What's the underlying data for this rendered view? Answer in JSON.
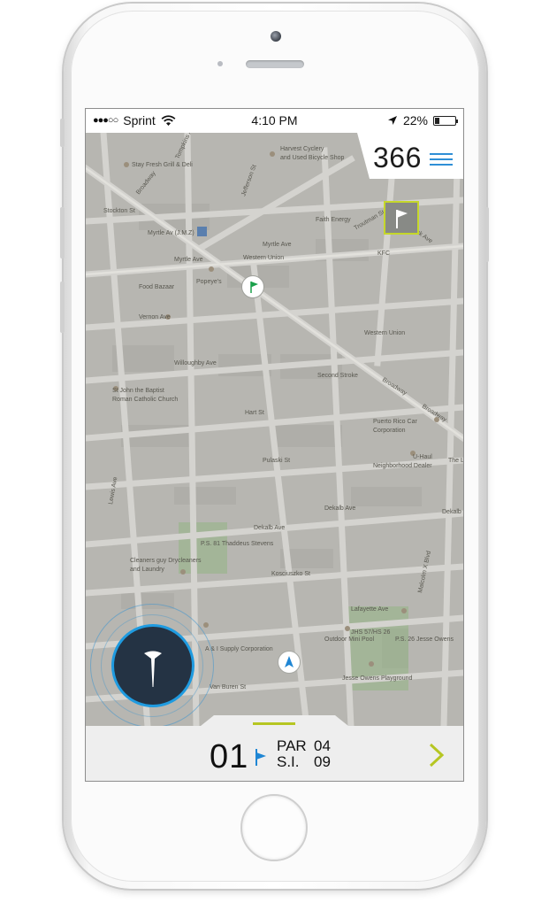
{
  "status_bar": {
    "signal": "●●●○○",
    "carrier": "Sprint",
    "time": "4:10 PM",
    "battery": "22%",
    "battery_level": 0.22
  },
  "map": {
    "labels": [
      "Stay Fresh Grill & Deli",
      "Harvest Cyclery",
      "and Used Bicycle Shop",
      "Stockton St",
      "Faith Energy",
      "Myrtle Av (J.M.Z)",
      "Myrtle Ave",
      "Myrtle Ave",
      "Western Union",
      "KFC",
      "Popeye's",
      "Food Bazaar",
      "Vernon Ave",
      "Western Union",
      "Willoughby Ave",
      "Second Stroke",
      "St John the Baptist",
      "Roman Catholic Church",
      "Hart St",
      "Puerto Rico Car",
      "Corporation",
      "Pulaski St",
      "U-Haul",
      "Neighborhood Dealer",
      "The Livin",
      "Dekalb Ave",
      "Dekalb Ave",
      "P.S. 81 Thaddeus Stevens",
      "Cleaners guy Drycleaners",
      "and Laundry",
      "Kosciuszko St",
      "Lafayette Ave",
      "JHS 57/HS 26",
      "Outdoor Mini Pool",
      "P.S. 26 Jesse Owens",
      "A & I Supply Corporation",
      "Jesse Owens Playground",
      "Van Buren St",
      "Broadway",
      "Broadway",
      "Broadway",
      "Malcolm X Blvd",
      "Lewis Ave",
      "Tompkins Ave",
      "Bushwick Ave",
      "Jefferson St",
      "Troutman St",
      "Dekalb"
    ]
  },
  "distance": {
    "value": "366"
  },
  "hole_bar": {
    "hole_number": "01",
    "par_label": "PAR",
    "par_value": "04",
    "si_label": "S.I.",
    "si_value": "09"
  },
  "colors": {
    "accent_blue": "#2f8fd6",
    "accent_lime": "#b6c622",
    "tee_dark": "#243344",
    "pin_green": "#1aa04a"
  }
}
